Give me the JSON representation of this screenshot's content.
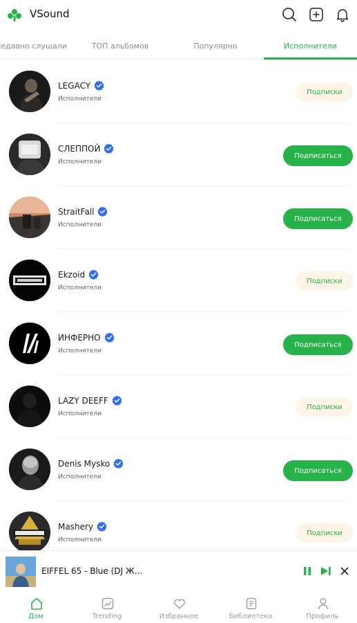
{
  "app": {
    "title": "VSound"
  },
  "header_icons": [
    "search-icon",
    "add-box-icon",
    "bell-icon"
  ],
  "tabs": [
    {
      "label": "Недавно слушали",
      "active": false
    },
    {
      "label": "ТОП альбомов",
      "active": false
    },
    {
      "label": "Популярно",
      "active": false
    },
    {
      "label": "Исполнители",
      "active": true
    }
  ],
  "artists": [
    {
      "name": "LEGACY",
      "subtitle": "Исполнители",
      "button": "Подписки",
      "subscribed": true
    },
    {
      "name": "СЛЕППОЙ",
      "subtitle": "Исполнители",
      "button": "Подписаться",
      "subscribed": false
    },
    {
      "name": "StraitFall",
      "subtitle": "Исполнители",
      "button": "Подписаться",
      "subscribed": false
    },
    {
      "name": "Ekzoid",
      "subtitle": "Исполнители",
      "button": "Подписки",
      "subscribed": true
    },
    {
      "name": "ИНФЕРНО",
      "subtitle": "Исполнители",
      "button": "Подписаться",
      "subscribed": false
    },
    {
      "name": "LAZY DEEFF",
      "subtitle": "Исполнители",
      "button": "Подписки",
      "subscribed": true
    },
    {
      "name": "Denis Mysko",
      "subtitle": "Исполнители",
      "button": "Подписаться",
      "subscribed": false
    },
    {
      "name": "Mashery",
      "subtitle": "Исполнители",
      "button": "Подписки",
      "subscribed": true
    }
  ],
  "player": {
    "track": "EIFFEL 65 - Blue (DJ Ж..."
  },
  "nav": [
    {
      "label": "Дом",
      "active": true,
      "icon": "home-icon"
    },
    {
      "label": "Trending",
      "active": false,
      "icon": "trending-icon"
    },
    {
      "label": "Избранное",
      "active": false,
      "icon": "heart-icon"
    },
    {
      "label": "Библиотека",
      "active": false,
      "icon": "library-icon"
    },
    {
      "label": "Профиль",
      "active": false,
      "icon": "profile-icon"
    }
  ],
  "colors": {
    "accent": "#27b24a",
    "subscribed_bg": "#fdf3e7",
    "verified": "#2f6ff0"
  }
}
